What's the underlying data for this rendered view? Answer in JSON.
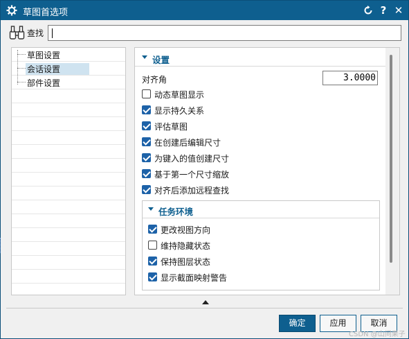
{
  "titlebar": {
    "icon": "gear-icon",
    "title": "草图首选项",
    "reset_icon": "reset-icon",
    "help_symbol": "?",
    "close_symbol": "✕"
  },
  "search": {
    "label": "查找",
    "icon": "binoculars-icon",
    "value": ""
  },
  "tree": {
    "items": [
      {
        "label": "草图设置"
      },
      {
        "label": "会话设置",
        "selected": true
      },
      {
        "label": "部件设置"
      }
    ]
  },
  "settings": {
    "section_title": "设置",
    "snap_angle_label": "对齐角",
    "snap_angle_value": "3.0000",
    "checkboxes": [
      {
        "label": "动态草图显示",
        "checked": false
      },
      {
        "label": "显示持久关系",
        "checked": true
      },
      {
        "label": "评估草图",
        "checked": true
      },
      {
        "label": "在创建后编辑尺寸",
        "checked": true
      },
      {
        "label": "为键入的值创建尺寸",
        "checked": true
      },
      {
        "label": "基于第一个尺寸缩放",
        "checked": true
      },
      {
        "label": "对齐后添加远程查找",
        "checked": true
      }
    ],
    "task_env": {
      "title": "任务环境",
      "checkboxes": [
        {
          "label": "更改视图方向",
          "checked": true
        },
        {
          "label": "维持隐藏状态",
          "checked": false
        },
        {
          "label": "保持图层状态",
          "checked": true
        },
        {
          "label": "显示截面映射警告",
          "checked": true
        }
      ]
    }
  },
  "buttons": {
    "ok": "确定",
    "apply": "应用",
    "cancel": "取消"
  },
  "colors": {
    "titlebar": "#0e5f8f",
    "accent": "#1d62a8",
    "selection": "#cfe3f0"
  },
  "watermark": "CSDN @山间果子"
}
